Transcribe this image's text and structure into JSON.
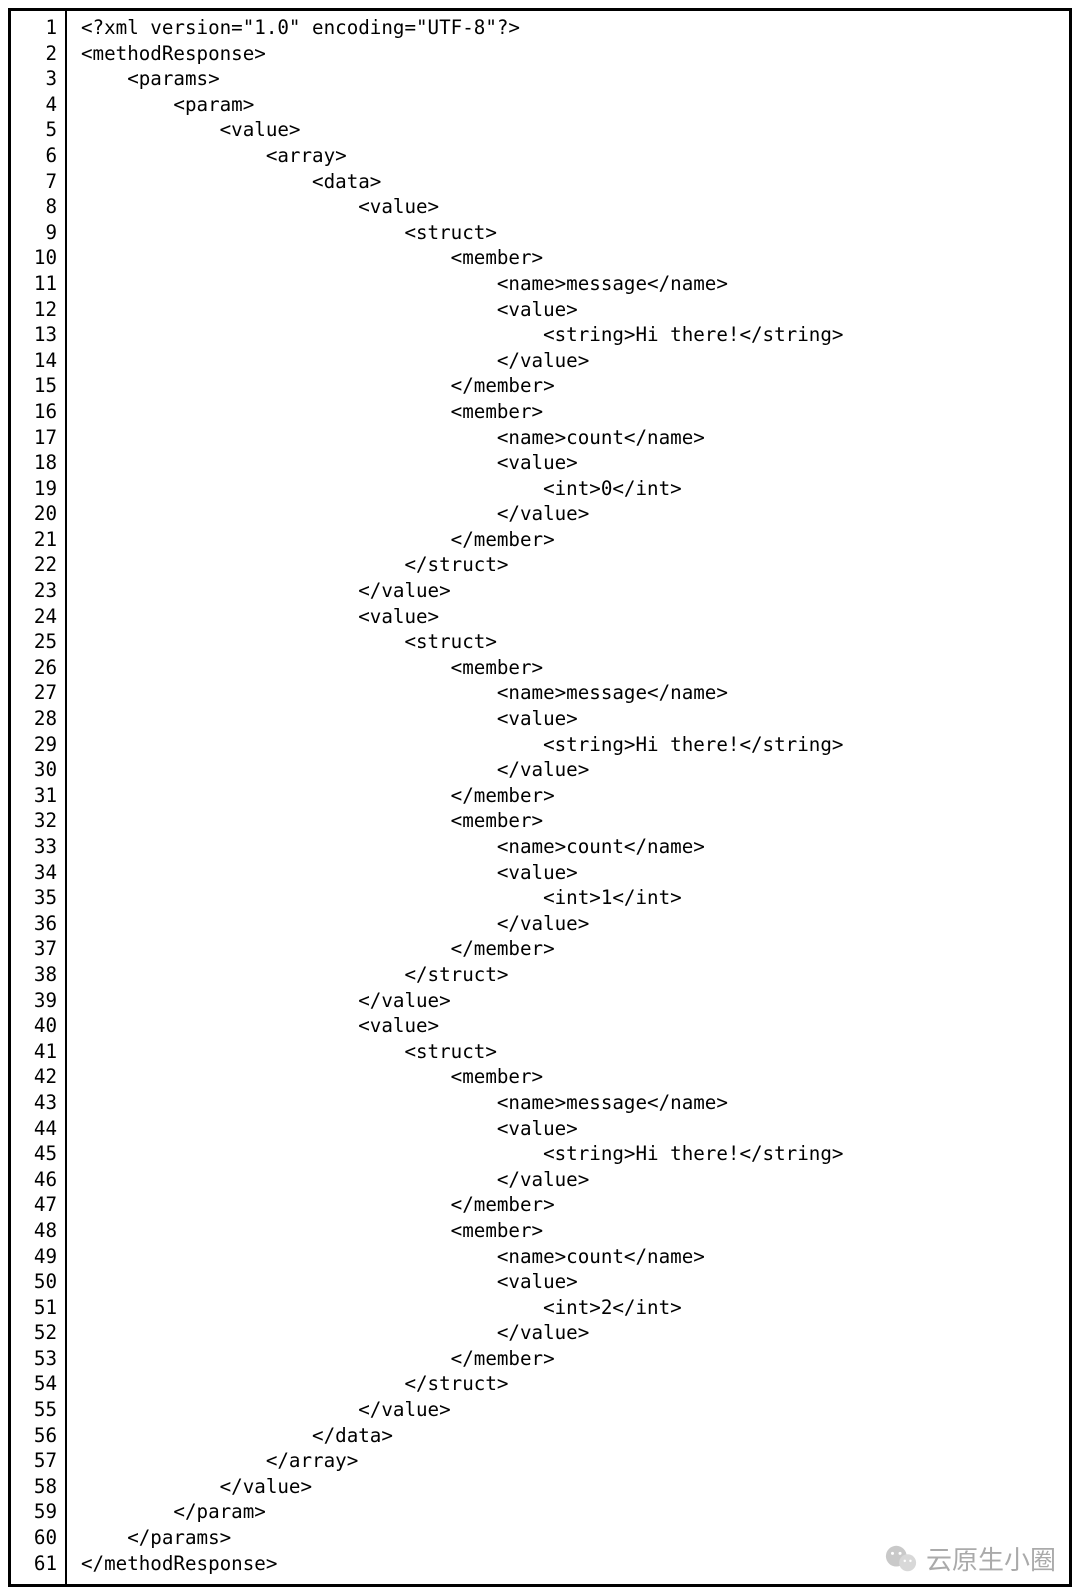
{
  "watermark": {
    "text": "云原生小圈"
  },
  "code": {
    "indent_unit": "    ",
    "lines": [
      {
        "n": 1,
        "indent": 0,
        "text": "<?xml version=\"1.0\" encoding=\"UTF-8\"?>"
      },
      {
        "n": 2,
        "indent": 0,
        "text": "<methodResponse>"
      },
      {
        "n": 3,
        "indent": 1,
        "text": "<params>"
      },
      {
        "n": 4,
        "indent": 2,
        "text": "<param>"
      },
      {
        "n": 5,
        "indent": 3,
        "text": "<value>"
      },
      {
        "n": 6,
        "indent": 4,
        "text": "<array>"
      },
      {
        "n": 7,
        "indent": 5,
        "text": "<data>"
      },
      {
        "n": 8,
        "indent": 6,
        "text": "<value>"
      },
      {
        "n": 9,
        "indent": 7,
        "text": "<struct>"
      },
      {
        "n": 10,
        "indent": 8,
        "text": "<member>"
      },
      {
        "n": 11,
        "indent": 9,
        "text": "<name>message</name>"
      },
      {
        "n": 12,
        "indent": 9,
        "text": "<value>"
      },
      {
        "n": 13,
        "indent": 10,
        "text": "<string>Hi there!</string>"
      },
      {
        "n": 14,
        "indent": 9,
        "text": "</value>"
      },
      {
        "n": 15,
        "indent": 8,
        "text": "</member>"
      },
      {
        "n": 16,
        "indent": 8,
        "text": "<member>"
      },
      {
        "n": 17,
        "indent": 9,
        "text": "<name>count</name>"
      },
      {
        "n": 18,
        "indent": 9,
        "text": "<value>"
      },
      {
        "n": 19,
        "indent": 10,
        "text": "<int>0</int>"
      },
      {
        "n": 20,
        "indent": 9,
        "text": "</value>"
      },
      {
        "n": 21,
        "indent": 8,
        "text": "</member>"
      },
      {
        "n": 22,
        "indent": 7,
        "text": "</struct>"
      },
      {
        "n": 23,
        "indent": 6,
        "text": "</value>"
      },
      {
        "n": 24,
        "indent": 6,
        "text": "<value>"
      },
      {
        "n": 25,
        "indent": 7,
        "text": "<struct>"
      },
      {
        "n": 26,
        "indent": 8,
        "text": "<member>"
      },
      {
        "n": 27,
        "indent": 9,
        "text": "<name>message</name>"
      },
      {
        "n": 28,
        "indent": 9,
        "text": "<value>"
      },
      {
        "n": 29,
        "indent": 10,
        "text": "<string>Hi there!</string>"
      },
      {
        "n": 30,
        "indent": 9,
        "text": "</value>"
      },
      {
        "n": 31,
        "indent": 8,
        "text": "</member>"
      },
      {
        "n": 32,
        "indent": 8,
        "text": "<member>"
      },
      {
        "n": 33,
        "indent": 9,
        "text": "<name>count</name>"
      },
      {
        "n": 34,
        "indent": 9,
        "text": "<value>"
      },
      {
        "n": 35,
        "indent": 10,
        "text": "<int>1</int>"
      },
      {
        "n": 36,
        "indent": 9,
        "text": "</value>"
      },
      {
        "n": 37,
        "indent": 8,
        "text": "</member>"
      },
      {
        "n": 38,
        "indent": 7,
        "text": "</struct>"
      },
      {
        "n": 39,
        "indent": 6,
        "text": "</value>"
      },
      {
        "n": 40,
        "indent": 6,
        "text": "<value>"
      },
      {
        "n": 41,
        "indent": 7,
        "text": "<struct>"
      },
      {
        "n": 42,
        "indent": 8,
        "text": "<member>"
      },
      {
        "n": 43,
        "indent": 9,
        "text": "<name>message</name>"
      },
      {
        "n": 44,
        "indent": 9,
        "text": "<value>"
      },
      {
        "n": 45,
        "indent": 10,
        "text": "<string>Hi there!</string>"
      },
      {
        "n": 46,
        "indent": 9,
        "text": "</value>"
      },
      {
        "n": 47,
        "indent": 8,
        "text": "</member>"
      },
      {
        "n": 48,
        "indent": 8,
        "text": "<member>"
      },
      {
        "n": 49,
        "indent": 9,
        "text": "<name>count</name>"
      },
      {
        "n": 50,
        "indent": 9,
        "text": "<value>"
      },
      {
        "n": 51,
        "indent": 10,
        "text": "<int>2</int>"
      },
      {
        "n": 52,
        "indent": 9,
        "text": "</value>"
      },
      {
        "n": 53,
        "indent": 8,
        "text": "</member>"
      },
      {
        "n": 54,
        "indent": 7,
        "text": "</struct>"
      },
      {
        "n": 55,
        "indent": 6,
        "text": "</value>"
      },
      {
        "n": 56,
        "indent": 5,
        "text": "</data>"
      },
      {
        "n": 57,
        "indent": 4,
        "text": "</array>"
      },
      {
        "n": 58,
        "indent": 3,
        "text": "</value>"
      },
      {
        "n": 59,
        "indent": 2,
        "text": "</param>"
      },
      {
        "n": 60,
        "indent": 1,
        "text": "</params>"
      },
      {
        "n": 61,
        "indent": 0,
        "text": "</methodResponse>"
      }
    ]
  }
}
